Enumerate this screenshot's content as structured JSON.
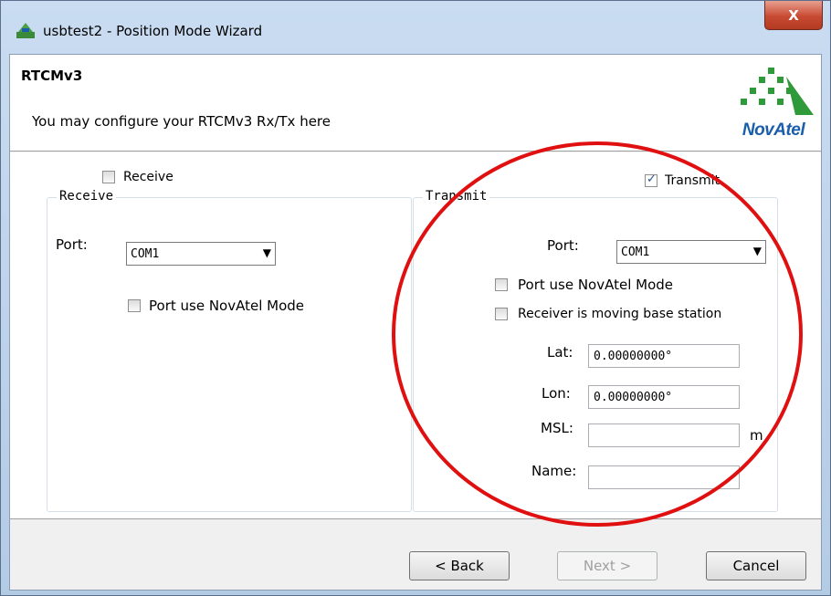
{
  "window": {
    "title": "usbtest2 - Position Mode Wizard",
    "close_label": "X"
  },
  "header": {
    "title": "RTCMv3",
    "subtitle": "You may configure your RTCMv3 Rx/Tx here",
    "logo_text": "NovAtel"
  },
  "receive": {
    "checkbox_label": "Receive",
    "checked": false,
    "group_title": "Receive",
    "port_label": "Port:",
    "port_value": "COM1",
    "novatel_mode_label": "Port use NovAtel Mode"
  },
  "transmit": {
    "checkbox_label": "Transmit",
    "checked": true,
    "group_title": "Transmit",
    "port_label": "Port:",
    "port_value": "COM1",
    "novatel_mode_label": "Port use NovAtel Mode",
    "moving_base_label": "Receiver is moving base station",
    "lat_label": "Lat:",
    "lat_value": "0.00000000°",
    "lon_label": "Lon:",
    "lon_value": "0.00000000°",
    "msl_label": "MSL:",
    "msl_value": "",
    "msl_unit": "m",
    "name_label": "Name:",
    "name_value": ""
  },
  "footer": {
    "back_label": "< Back",
    "next_label": "Next >",
    "cancel_label": "Cancel"
  },
  "colors": {
    "annotation_circle": "#e01010",
    "logo_blue": "#1a5eab",
    "logo_green": "#2e9a3a"
  }
}
